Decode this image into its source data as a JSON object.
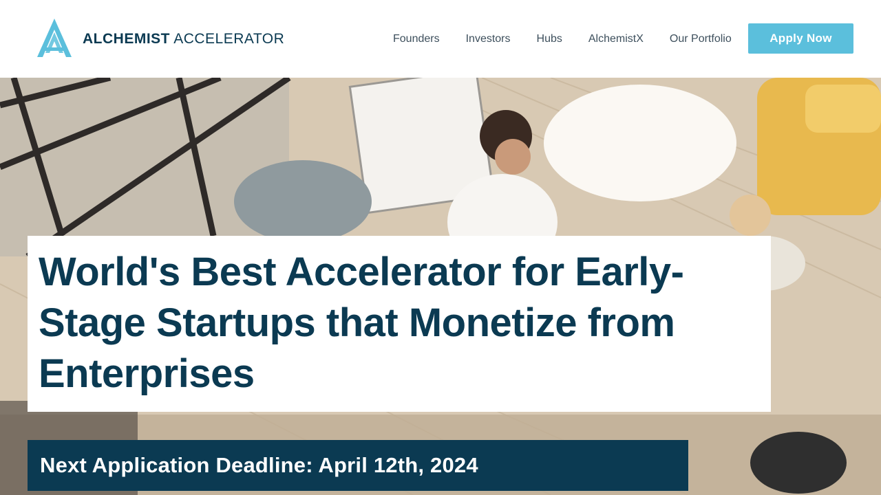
{
  "brand": {
    "name_bold": "ALCHEMIST",
    "name_light": "ACCELERATOR",
    "logo_icon": "alchemist-a-logo",
    "accent_color": "#5bbfdc",
    "primary_color": "#0b3a52"
  },
  "nav": {
    "items": [
      {
        "label": "Founders"
      },
      {
        "label": "Investors"
      },
      {
        "label": "Hubs"
      },
      {
        "label": "AlchemistX"
      },
      {
        "label": "Our Portfolio"
      }
    ],
    "cta_label": "Apply Now"
  },
  "hero": {
    "headline": "World's Best Accelerator for Early-Stage Startups that Monetize from Enterprises",
    "deadline": "Next Application Deadline: April 12th, 2024"
  }
}
